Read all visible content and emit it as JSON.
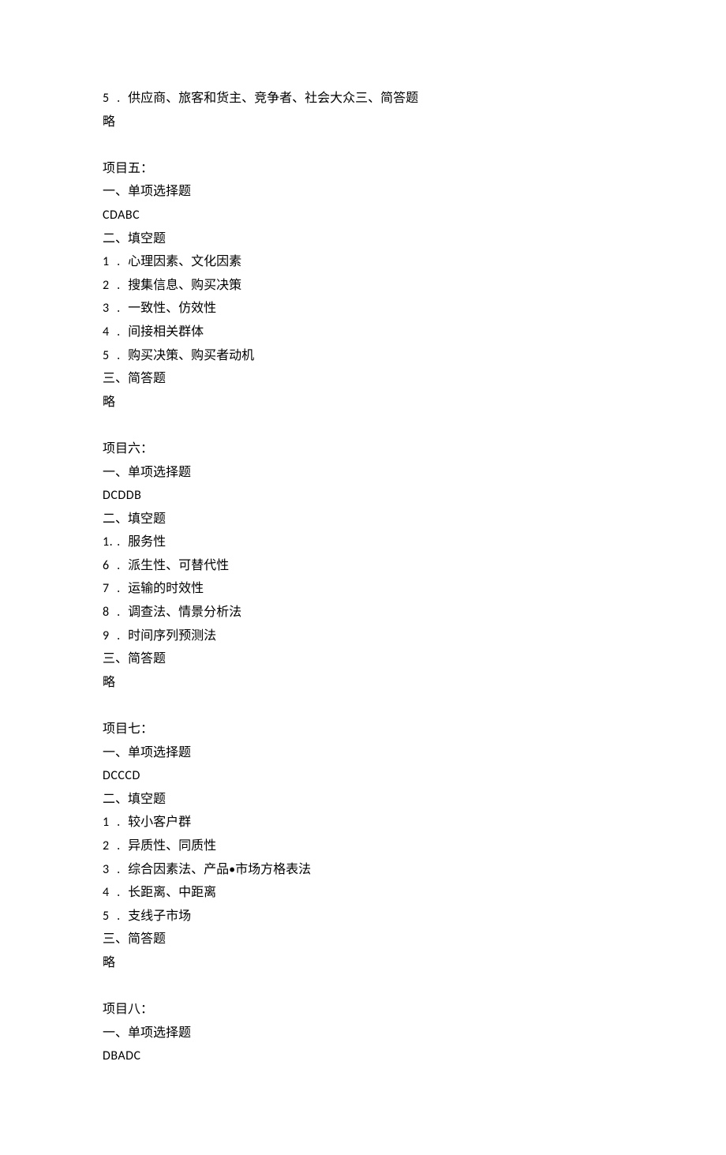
{
  "top": {
    "q5": "供应商、旅客和货主、竞争者、社会大众三、简答题",
    "omit": "略"
  },
  "sections": [
    {
      "title": "项目五：",
      "s1_label": "一、单项选择题",
      "answers": "CDABC",
      "s2_label": "二、填空题",
      "fills": [
        {
          "n": "1",
          "sep": " . ",
          "text": "心理因素、文化因素"
        },
        {
          "n": "2",
          "sep": "   .",
          "text": "搜集信息、购买决策"
        },
        {
          "n": "3",
          "sep": "   .",
          "text": "一致性、仿效性"
        },
        {
          "n": "4",
          "sep": "   .",
          "text": "间接相关群体"
        },
        {
          "n": "5",
          "sep": "   .",
          "text": "购买决策、购买者动机"
        }
      ],
      "s3_label": "三、简答题",
      "omit": "略"
    },
    {
      "title": "项目六：",
      "s1_label": "一、单项选择题",
      "answers": "DCDDB",
      "s2_label": "二、填空题",
      "fills": [
        {
          "n": "1.",
          "sep": " ",
          "text": "服务性"
        },
        {
          "n": "6",
          "sep": "   .",
          "text": "派生性、可替代性"
        },
        {
          "n": "7",
          "sep": "   .",
          "text": "运输的时效性"
        },
        {
          "n": "8",
          "sep": "   . ",
          "text": "调查法、情景分析法"
        },
        {
          "n": "9",
          "sep": "   .",
          "text": "时间序列预测法"
        }
      ],
      "s3_label": "三、简答题",
      "omit": "略"
    },
    {
      "title": "项目七：",
      "s1_label": "一、单项选择题",
      "answers": "DCCCD",
      "s2_label": "二、填空题",
      "fills": [
        {
          "n": "1",
          "sep": "   .",
          "text": "较小客户群"
        },
        {
          "n": "2",
          "sep": "   .",
          "text": "异质性、同质性"
        },
        {
          "n": "3",
          "sep": "   .",
          "text": "综合因素法、产品•市场方格表法"
        },
        {
          "n": "4",
          "sep": "   .",
          "text": "长距离、中距离"
        },
        {
          "n": "5",
          "sep": "   .",
          "text": "支线子市场"
        }
      ],
      "s3_label": "三、简答题",
      "omit": "略"
    },
    {
      "title": "项目八：",
      "s1_label": "一、单项选择题",
      "answers": "DBADC"
    }
  ]
}
